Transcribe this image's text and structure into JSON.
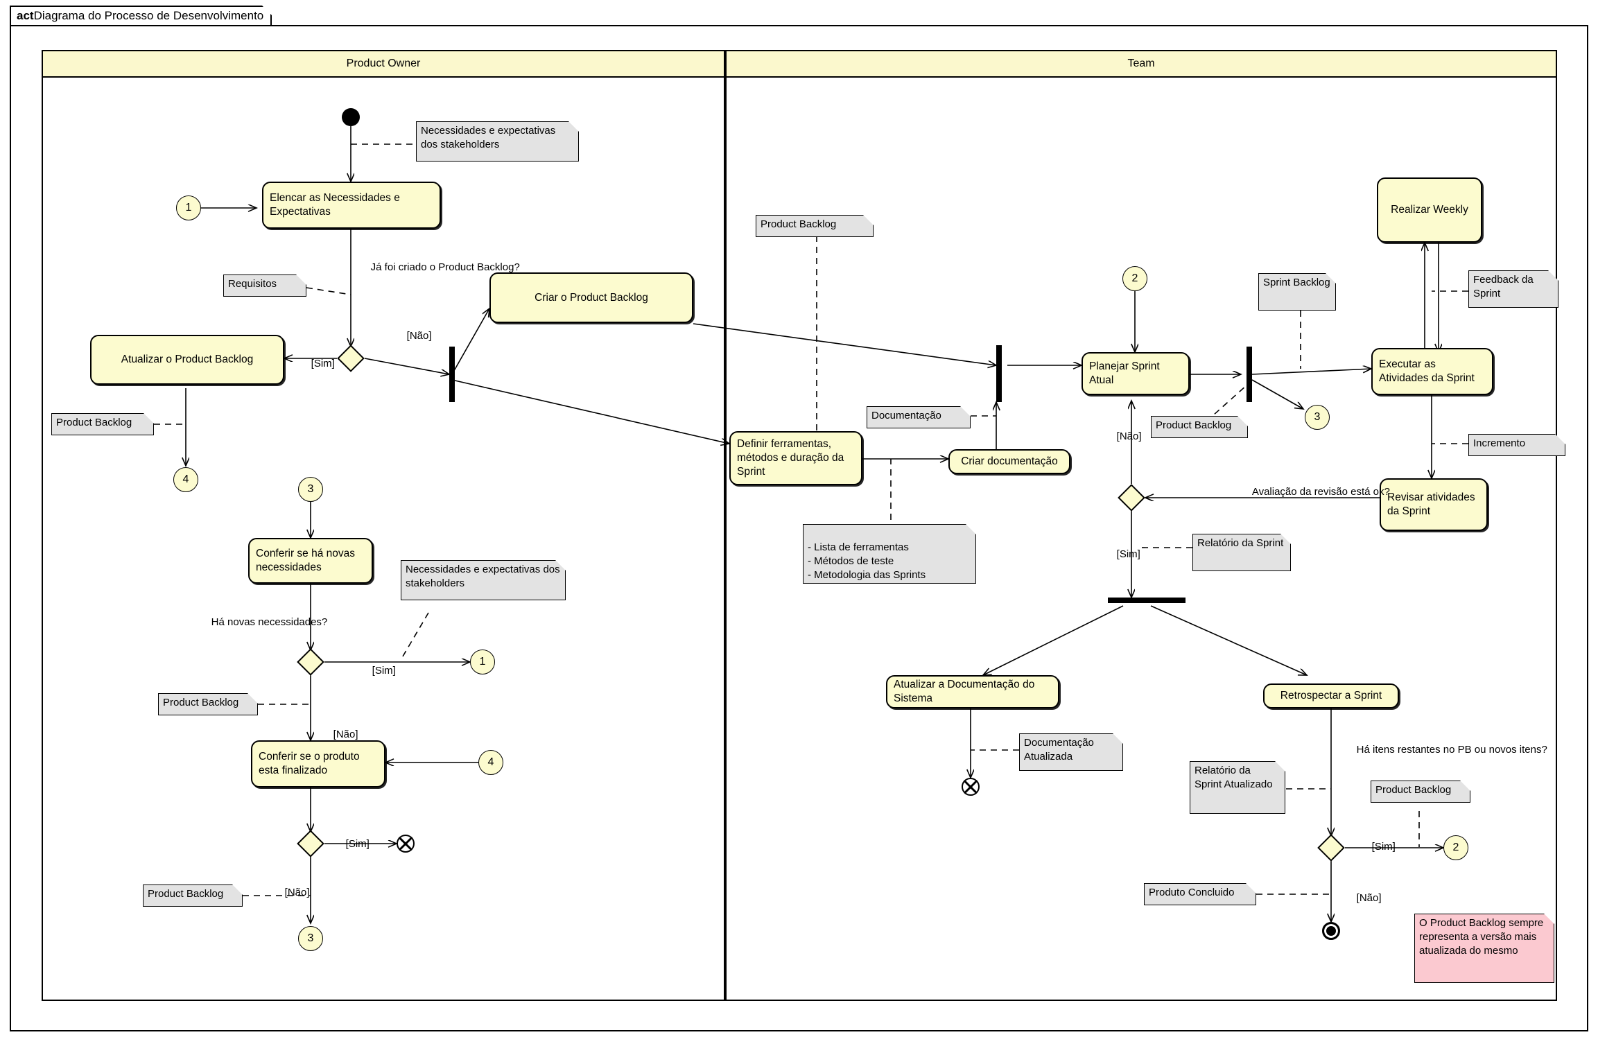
{
  "diagram": {
    "stereotype": "act",
    "title": "Diagrama do Processo de Desenvolvimento"
  },
  "lanes": [
    {
      "id": "product-owner",
      "label": "Product Owner"
    },
    {
      "id": "team",
      "label": "Team"
    }
  ],
  "colors": {
    "action_fill": "#fcfbcf",
    "lane_header_fill": "#fbf8cd",
    "note_fill": "#e3e3e3",
    "note_pink_fill": "#fbc9d0",
    "stroke": "#000000"
  },
  "actions": [
    {
      "id": "elencar",
      "label": "Elencar as Necessidades e Expectativas"
    },
    {
      "id": "atualizar-pb",
      "label": "Atualizar o Product Backlog"
    },
    {
      "id": "criar-pb",
      "label": "Criar o Product Backlog"
    },
    {
      "id": "conferir-novas",
      "label": "Conferir se há novas necessidades"
    },
    {
      "id": "conferir-finalizado",
      "label": "Conferir se o produto esta finalizado"
    },
    {
      "id": "definir-ferramentas",
      "label": "Definir ferramentas, métodos e duração da Sprint"
    },
    {
      "id": "criar-doc",
      "label": "Criar documentação"
    },
    {
      "id": "planejar-sprint",
      "label": "Planejar Sprint Atual"
    },
    {
      "id": "executar-ativ",
      "label": "Executar as Atividades da Sprint"
    },
    {
      "id": "realizar-weekly",
      "label": "Realizar Weekly"
    },
    {
      "id": "revisar-ativ",
      "label": "Revisar atividades da Sprint"
    },
    {
      "id": "atualizar-doc",
      "label": "Atualizar a Documentação do Sistema"
    },
    {
      "id": "retrospectar",
      "label": "Retrospectar a Sprint"
    }
  ],
  "notes": [
    {
      "id": "note-necessidades-1",
      "label": "Necessidades e expectativas dos stakeholders"
    },
    {
      "id": "note-requisitos",
      "label": "Requisitos"
    },
    {
      "id": "note-pb-1",
      "label": "Product Backlog"
    },
    {
      "id": "note-necessidades-2",
      "label": "Necessidades e expectativas dos stakeholders"
    },
    {
      "id": "note-pb-2",
      "label": "Product Backlog"
    },
    {
      "id": "note-pb-3",
      "label": "Product Backlog"
    },
    {
      "id": "note-pb-team-1",
      "label": "Product Backlog"
    },
    {
      "id": "note-documentacao",
      "label": "Documentação"
    },
    {
      "id": "note-lista",
      "label": "- Lista de ferramentas\n- Métodos de teste\n- Metodologia das Sprints"
    },
    {
      "id": "note-pb-team-2",
      "label": "Product Backlog"
    },
    {
      "id": "note-sprint-backlog",
      "label": "Sprint Backlog"
    },
    {
      "id": "note-feedback",
      "label": "Feedback da Sprint"
    },
    {
      "id": "note-incremento",
      "label": "Incremento"
    },
    {
      "id": "note-relatorio",
      "label": "Relatório da Sprint"
    },
    {
      "id": "note-doc-atualizada",
      "label": "Documentação Atualizada"
    },
    {
      "id": "note-relatorio-atz",
      "label": "Relatório da Sprint Atualizado"
    },
    {
      "id": "note-pb-team-3",
      "label": "Product Backlog"
    },
    {
      "id": "note-produto-concl",
      "label": "Produto Concluido"
    },
    {
      "id": "note-pb-comment",
      "label": "O Product Backlog sempre representa a versão mais atualizada do mesmo"
    }
  ],
  "connectors": [
    {
      "id": "conn-1-left",
      "label": "1"
    },
    {
      "id": "conn-4-left",
      "label": "4"
    },
    {
      "id": "conn-3-left",
      "label": "3"
    },
    {
      "id": "conn-1-mid",
      "label": "1"
    },
    {
      "id": "conn-4-mid",
      "label": "4"
    },
    {
      "id": "conn-3-bottom",
      "label": "3"
    },
    {
      "id": "conn-2-team",
      "label": "2"
    },
    {
      "id": "conn-3-team",
      "label": "3"
    },
    {
      "id": "conn-2-bottom",
      "label": "2"
    }
  ],
  "guards": [
    {
      "id": "guard-ja-criado",
      "label": "Já foi criado o Product Backlog?"
    },
    {
      "id": "guard-nao-1",
      "label": "[Não]"
    },
    {
      "id": "guard-sim-1",
      "label": "[Sim]"
    },
    {
      "id": "guard-ha-novas",
      "label": "Há novas necessidades?"
    },
    {
      "id": "guard-sim-2",
      "label": "[Sim]"
    },
    {
      "id": "guard-nao-2",
      "label": "[Não]"
    },
    {
      "id": "guard-sim-3",
      "label": "[Sim]"
    },
    {
      "id": "guard-nao-3",
      "label": "[Não]"
    },
    {
      "id": "guard-nao-team",
      "label": "[Não]"
    },
    {
      "id": "guard-sim-team",
      "label": "[Sim]"
    },
    {
      "id": "guard-avaliacao",
      "label": "Avaliação da revisão está ok?"
    },
    {
      "id": "guard-ha-itens",
      "label": "Há itens restantes no PB ou novos itens?"
    },
    {
      "id": "guard-sim-4",
      "label": "[Sim]"
    },
    {
      "id": "guard-nao-4",
      "label": "[Não]"
    }
  ]
}
